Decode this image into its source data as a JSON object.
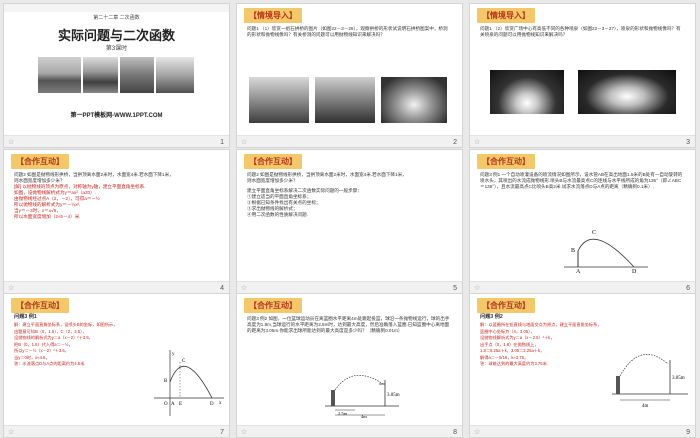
{
  "slides": [
    {
      "number": "1",
      "chapter": "第二十二章   二次函数",
      "title": "实际问题与二次函数",
      "subtitle": "第3课时",
      "website": "第一PPT模板网-WWW.1PPT.COM"
    },
    {
      "number": "2",
      "tag": "【情境导入】",
      "text": "问题1  （1）欣赏一组石拱桥的图片（如图22－3－26），观察拱桥的形状试说明石拱桥图案中，桥洞的形状和抛物线像吗？有关桥洞的问题可以用抛物线知识来解决吗？"
    },
    {
      "number": "3",
      "tag": "【情境导入】",
      "text": "问题1  （2）欣赏广场中心有高低不同的各种喷泉（如图22－3－27），喷泉的形状和抛物线像吗？有关喷泉的问题可以用抛物线知识来解决吗？"
    },
    {
      "number": "4",
      "tag": "【合作互动】",
      "lines": [
        "问题2  如图是抛物线形拱桥，当拱顶离水面2米时，水面宽4米.若水面下降1米，",
        "则水面宽度增加多少米？",
        "[解] 以抛物线的顶点为原点，对称轴为y轴，建立平面直角坐标系.",
        "如图，设抛物线解析式为y＝ax²（a≠0）.",
        "由抛物线经过点A（2，－2），可得a＝－½",
        "所以抛物线的解析式为y＝－½x².",
        "当y＝－3时，x＝±√6，",
        "所以水面宽度增加（2√6－4）米."
      ]
    },
    {
      "number": "5",
      "tag": "【合作互动】",
      "lines": [
        "问题2  如图是抛物线形拱桥，当拱顶离水面2米时，水面宽4米.若水面下降1米，",
        "则水面宽度增加多少米？",
        "建立平面直角坐标系解决二次函数实际问题的一般步骤：",
        "①建立适当的平面直角坐标系；",
        "②根据已知条件找出有关点的坐标；",
        "③求出抛物线的解析式；",
        "④用二次函数的性质解决问题."
      ]
    },
    {
      "number": "6",
      "tag": "【合作互动】",
      "text": "问题3  例1 一个自动喷灌设备的喷流情况如图所示，设水管AB在高出地面1.5米的B处有一自动旋转的喷水头，其喷出的水流成抛物线形.喷头B与水流最高点C的连线与水平线所成的角为135°（即∠ABC＝135°），且水流最高点C比喷头B高2米.试求水流落点D与A点的距离（精确到0.1米）.",
      "labels": {
        "b": "B",
        "c": "C",
        "a": "A",
        "d": "D"
      }
    },
    {
      "number": "7",
      "tag": "【合作互动】",
      "heading": "问题3  例1",
      "lines": [
        "解：建立平面直角坐标系，设喷头B的坐标，如图所示，",
        "由题意可知B（0，1.5），C（2，3.5），",
        "设抛物线的解析式为y＝a（x－2）²＋3.5，",
        "把B（0，1.5）代入得a＝－½，",
        "所以y＝－½（x－2）²＋3.5，",
        "当y＝0时，x≈4.6，",
        "答：水流落点D与A点的距离约为4.6米."
      ],
      "labels": {
        "y": "y",
        "x": "x",
        "c": "C",
        "b": "B",
        "o": "O",
        "a": "A",
        "e": "E",
        "d": "D"
      }
    },
    {
      "number": "8",
      "tag": "【合作互动】",
      "text": "问题3  例2 如图，一位篮球运动员在离篮圈水平距离4m处跳起投篮，球沿一条抛物线运行，球的出手高度为1.8m,当球运行的水平距离为2.5m时，达到最大高度，然后准确落入篮圈.已知篮圈中心离地面的距离为3.05m.你能求出球所能达到的最大高度是多少吗？（精确到0.01m）",
      "labels": {
        "m": "3.05m",
        "h": "2.5m",
        "w": "4m"
      }
    },
    {
      "number": "9",
      "tag": "【合作互动】",
      "heading": "问题3  例2",
      "lines": [
        "解：以篮圈所在铅直线与地面交点为原点，建立平面直角坐标系，",
        "篮圈中心坐标为（4，3.05），",
        "设抛物线解析式为y＝a（x－2.5）²＋k，",
        "出手点（0，1.8）在抛物线上，",
        "1.8＝6.25a＋k，3.05＝2.25a＋k，",
        "解得a＝－5/16，k≈3.75，",
        "答：球能达到的最大高度约为3.75米."
      ],
      "labels": {
        "m": "3.05m",
        "w": "4m"
      }
    }
  ]
}
